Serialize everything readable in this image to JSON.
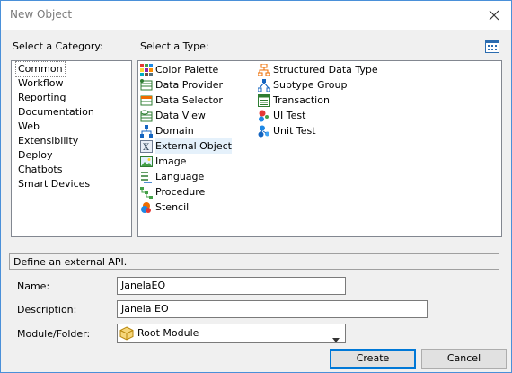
{
  "window": {
    "title": "New Object"
  },
  "category": {
    "label": "Select a Category:",
    "items": [
      "Common",
      "Workflow",
      "Reporting",
      "Documentation",
      "Web",
      "Extensibility",
      "Deploy",
      "Chatbots",
      "Smart Devices"
    ],
    "selected": "Common"
  },
  "type": {
    "label": "Select a Type:",
    "col1": [
      {
        "label": "Color Palette",
        "icon": "color-palette-icon"
      },
      {
        "label": "Data Provider",
        "icon": "data-provider-icon"
      },
      {
        "label": "Data Selector",
        "icon": "data-selector-icon"
      },
      {
        "label": "Data View",
        "icon": "data-view-icon"
      },
      {
        "label": "Domain",
        "icon": "domain-icon"
      },
      {
        "label": "External Object",
        "icon": "external-object-icon"
      },
      {
        "label": "Image",
        "icon": "image-icon"
      },
      {
        "label": "Language",
        "icon": "language-icon"
      },
      {
        "label": "Procedure",
        "icon": "procedure-icon"
      },
      {
        "label": "Stencil",
        "icon": "stencil-icon"
      }
    ],
    "col2": [
      {
        "label": "Structured Data Type",
        "icon": "sdt-icon"
      },
      {
        "label": "Subtype Group",
        "icon": "subtype-group-icon"
      },
      {
        "label": "Transaction",
        "icon": "transaction-icon"
      },
      {
        "label": "UI Test",
        "icon": "ui-test-icon"
      },
      {
        "label": "Unit Test",
        "icon": "unit-test-icon"
      }
    ],
    "selected": "External Object"
  },
  "description_text": "Define an external API.",
  "form": {
    "name_label": "Name:",
    "name_value": "JanelaEO",
    "description_label": "Description:",
    "description_value": "Janela EO",
    "module_label": "Module/Folder:",
    "module_value": "Root Module"
  },
  "buttons": {
    "create": "Create",
    "cancel": "Cancel"
  }
}
